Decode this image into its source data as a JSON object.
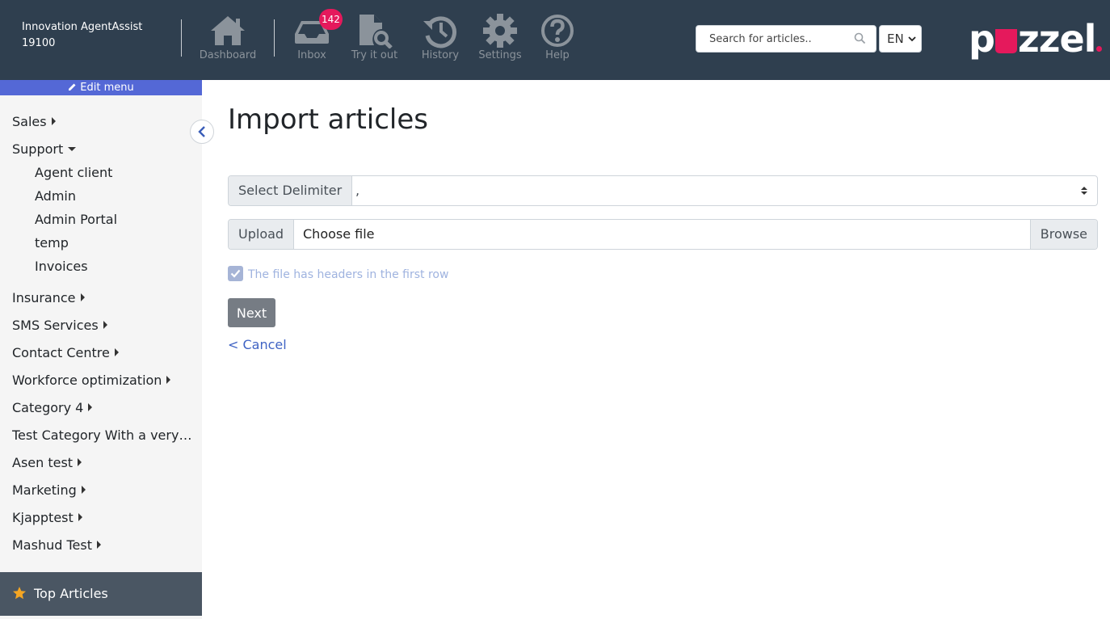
{
  "header": {
    "app_name": "Innovation AgentAssist",
    "app_id": "19100",
    "nav": [
      {
        "label": "Dashboard",
        "icon": "home-icon"
      },
      {
        "label": "Inbox",
        "icon": "inbox-icon",
        "badge": "142"
      },
      {
        "label": "Try it out",
        "icon": "document-search-icon"
      },
      {
        "label": "History",
        "icon": "history-icon"
      },
      {
        "label": "Settings",
        "icon": "gear-icon"
      },
      {
        "label": "Help",
        "icon": "help-icon"
      }
    ],
    "search": {
      "placeholder": "Search for articles..",
      "value": ""
    },
    "language": "EN",
    "logo_text_left": "p",
    "logo_text_right": "zzel",
    "colors": {
      "background": "#2f3f4f",
      "accent": "#e5195c",
      "nav_icon": "#8b939b"
    }
  },
  "sidebar": {
    "edit_menu_label": "Edit menu",
    "categories": [
      {
        "label": "Sales",
        "expanded": false
      },
      {
        "label": "Support",
        "expanded": true,
        "children": [
          "Agent client",
          "Admin",
          "Admin Portal",
          "temp",
          "Invoices"
        ]
      },
      {
        "label": "Insurance",
        "expanded": false
      },
      {
        "label": "SMS Services",
        "expanded": false
      },
      {
        "label": "Contact Centre",
        "expanded": false
      },
      {
        "label": "Workforce optimization",
        "expanded": false
      },
      {
        "label": "Category 4",
        "expanded": false
      },
      {
        "label": "Test Category With a very long name",
        "expanded": false
      },
      {
        "label": "Asen test",
        "expanded": false
      },
      {
        "label": "Marketing",
        "expanded": false
      },
      {
        "label": "Kjapptest",
        "expanded": false
      },
      {
        "label": "Mashud Test",
        "expanded": false
      }
    ],
    "top_articles_label": "Top Articles",
    "colors": {
      "edit_menu": "#5468d6",
      "top_articles_bg": "#4a5663",
      "star": "#f5a623"
    }
  },
  "main": {
    "title": "Import articles",
    "delimiter": {
      "label": "Select Delimiter",
      "value": ","
    },
    "upload": {
      "label": "Upload",
      "placeholder": "Choose file",
      "browse_label": "Browse"
    },
    "headers_checkbox": {
      "label": "The file has headers in the first row",
      "checked": true
    },
    "next_label": "Next",
    "cancel_label": "< Cancel",
    "colors": {
      "link": "#3f63c4",
      "button": "#767c84"
    }
  }
}
